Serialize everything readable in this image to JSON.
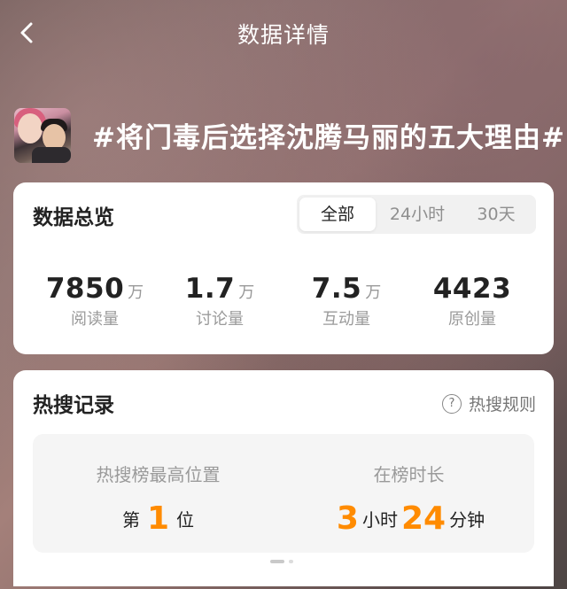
{
  "header": {
    "title": "数据详情",
    "back_icon": "chevron-left-icon"
  },
  "topic": {
    "title": "#将门毒后选择沈腾马丽的五大理由#"
  },
  "overview": {
    "title": "数据总览",
    "tabs": [
      {
        "label": "全部",
        "active": true
      },
      {
        "label": "24小时",
        "active": false
      },
      {
        "label": "30天",
        "active": false
      }
    ],
    "stats": [
      {
        "value": "7850",
        "unit": "万",
        "label": "阅读量"
      },
      {
        "value": "1.7",
        "unit": "万",
        "label": "讨论量"
      },
      {
        "value": "7.5",
        "unit": "万",
        "label": "互动量"
      },
      {
        "value": "4423",
        "unit": "",
        "label": "原创量"
      }
    ]
  },
  "hot": {
    "title": "热搜记录",
    "rules_label": "热搜规则",
    "rules_icon": "question-circle-icon",
    "peak_label": "热搜榜最高位置",
    "peak_prefix": "第",
    "peak_value": "1",
    "peak_suffix": "位",
    "duration_label": "在榜时长",
    "hours": "3",
    "hours_unit": "小时",
    "minutes": "24",
    "minutes_unit": "分钟"
  },
  "colors": {
    "accent": "#ff8b00",
    "text": "#222222",
    "muted": "#9a9a9a"
  }
}
